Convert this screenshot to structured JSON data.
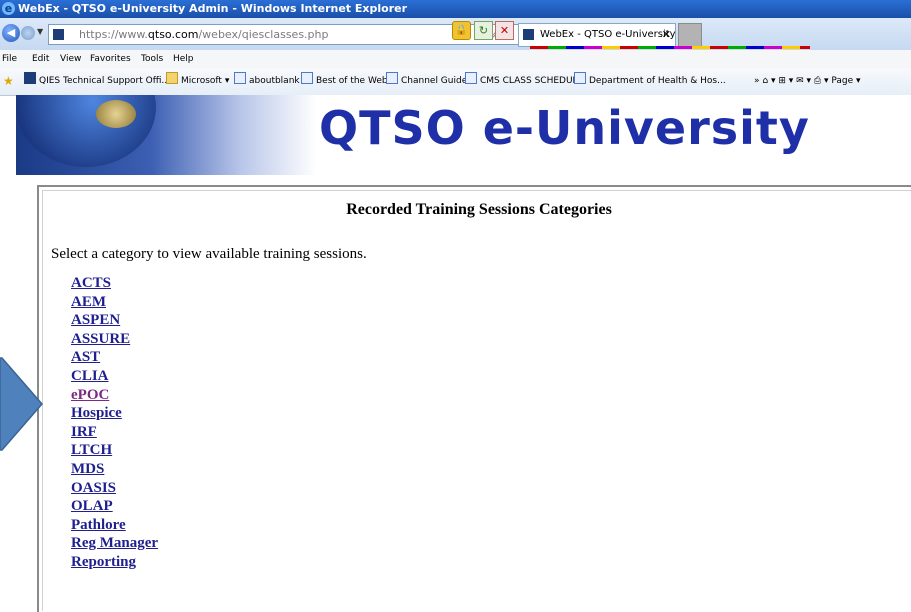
{
  "window": {
    "title": "WebEx - QTSO e-University Admin - Windows Internet Explorer"
  },
  "address_bar": {
    "url_prefix": "https://www.",
    "url_domain": "qtso.com",
    "url_path": "/webex/qiesclasses.php"
  },
  "tab": {
    "label": "WebEx - QTSO e-University ..."
  },
  "menu": {
    "items": [
      "File",
      "Edit",
      "View",
      "Favorites",
      "Tools",
      "Help"
    ]
  },
  "favorites": {
    "items": [
      {
        "label": "QIES Technical Support Offi...",
        "icon": "page-icon"
      },
      {
        "label": "Microsoft ▾",
        "icon": "folder-icon"
      },
      {
        "label": "aboutblank",
        "icon": "ie-page-icon"
      },
      {
        "label": "Best of the Web",
        "icon": "ie-page-icon"
      },
      {
        "label": "Channel Guide",
        "icon": "ie-page-icon"
      },
      {
        "label": "CMS CLASS SCHEDULE",
        "icon": "ie-page-icon"
      },
      {
        "label": "Department of Health & Hos...",
        "icon": "ie-page-icon"
      }
    ],
    "right_tools": "» ⌂ ▾ ⊞ ▾ ✉ ▾ ⎙ ▾ Page ▾"
  },
  "banner": {
    "title": "QTSO e-University"
  },
  "content": {
    "heading": "Recorded Training Sessions Categories",
    "intro": "Select a category to view available training sessions.",
    "categories": [
      {
        "label": "ACTS",
        "visited": false
      },
      {
        "label": "AEM",
        "visited": false
      },
      {
        "label": "ASPEN",
        "visited": false
      },
      {
        "label": "ASSURE",
        "visited": false
      },
      {
        "label": "AST",
        "visited": false
      },
      {
        "label": "CLIA",
        "visited": false
      },
      {
        "label": "ePOC",
        "visited": true
      },
      {
        "label": "Hospice",
        "visited": false
      },
      {
        "label": "IRF",
        "visited": false
      },
      {
        "label": "LTCH",
        "visited": false
      },
      {
        "label": "MDS",
        "visited": false
      },
      {
        "label": "OASIS",
        "visited": false
      },
      {
        "label": "OLAP",
        "visited": false
      },
      {
        "label": "Pathlore",
        "visited": false
      },
      {
        "label": "Reg Manager",
        "visited": false
      },
      {
        "label": "Reporting",
        "visited": false
      }
    ]
  },
  "colors": {
    "link": "#1f1f8f",
    "visited_link": "#7a2a84",
    "banner_text": "#1e2fa8",
    "arrow_fill": "#4f81bd"
  }
}
